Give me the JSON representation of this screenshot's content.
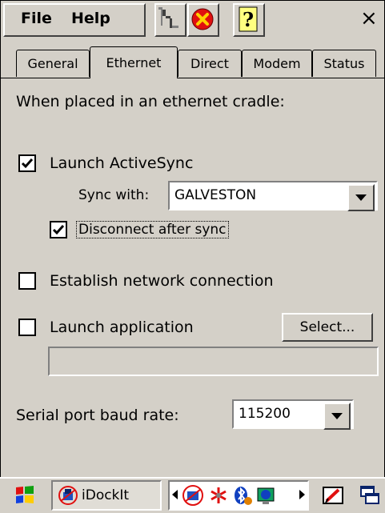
{
  "menubar": {
    "file_label": "File",
    "help_label": "Help",
    "close_glyph": "×"
  },
  "toolbar_icons": [
    "network-icon",
    "stop-icon",
    "help-icon"
  ],
  "tabs": [
    {
      "label": "General",
      "active": false
    },
    {
      "label": "Ethernet",
      "active": true
    },
    {
      "label": "Direct",
      "active": false
    },
    {
      "label": "Modem",
      "active": false
    },
    {
      "label": "Status",
      "active": false
    }
  ],
  "heading": "When placed in an ethernet cradle:",
  "launch_activesync": {
    "label": "Launch ActiveSync",
    "checked": true
  },
  "sync_with": {
    "label": "Sync with:",
    "value": "GALVESTON"
  },
  "disconnect_after_sync": {
    "label": "Disconnect after sync",
    "checked": true
  },
  "establish_network": {
    "label": "Establish network connection",
    "checked": false
  },
  "launch_application": {
    "label": "Launch application",
    "checked": false,
    "path_value": ""
  },
  "select_button": "Select...",
  "baud_rate": {
    "label": "Serial port baud rate:",
    "value": "115200"
  },
  "taskbar": {
    "app_label": "iDockIt"
  },
  "colors": {
    "stop_red": "#e01010",
    "selection_blue": "#0a246a"
  }
}
